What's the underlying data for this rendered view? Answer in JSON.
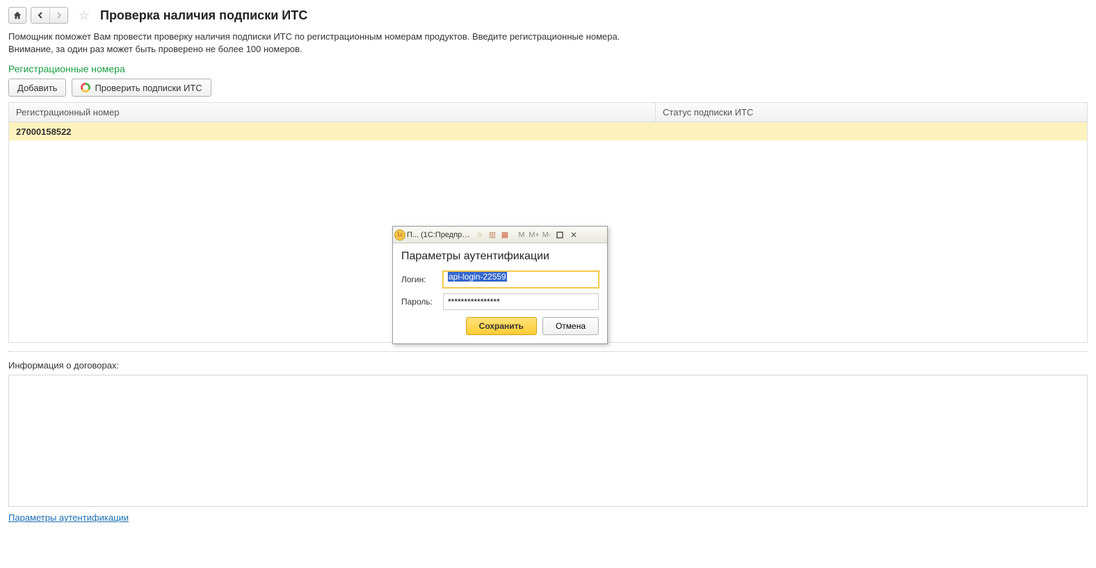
{
  "page": {
    "title": "Проверка наличия подписки ИТС",
    "description_line1": "Помощник поможет Вам провести проверку наличия подписки ИТС по регистрационным номерам продуктов. Введите регистрационные номера.",
    "description_line2": "Внимание, за один раз может быть проверено не более 100 номеров."
  },
  "section": {
    "title": "Регистрационные номера"
  },
  "buttons": {
    "add": "Добавить",
    "check": "Проверить подписки ИТС"
  },
  "table": {
    "headers": {
      "reg_number": "Регистрационный номер",
      "status": "Статус подписки ИТС"
    },
    "rows": [
      {
        "reg_number": "27000158522",
        "status": ""
      }
    ]
  },
  "contracts": {
    "label": "Информация о договорах:"
  },
  "footer": {
    "auth_link": "Параметры аутентификации"
  },
  "dialog": {
    "window_title": "П... (1С:Предприя..",
    "header": "Параметры аутентификации",
    "label_login": "Логин:",
    "label_password": "Пароль:",
    "login_value": "api-login-22559",
    "password_value": "****************",
    "save": "Сохранить",
    "cancel": "Отмена",
    "mini": {
      "m": "M",
      "mplus": "M+",
      "mminus": "M-"
    }
  }
}
